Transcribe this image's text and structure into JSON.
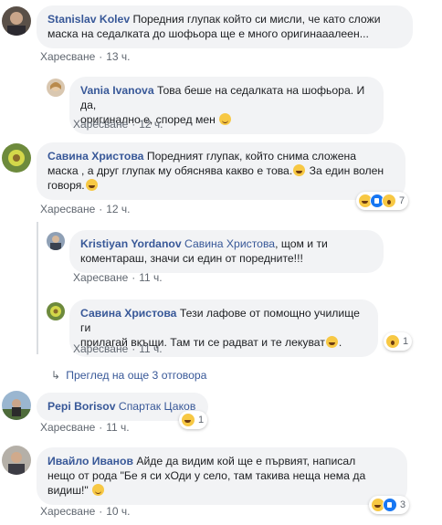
{
  "labels": {
    "like": "Харесване",
    "dot": "·"
  },
  "comments": [
    {
      "author": "Stanislav Kolev",
      "line1": "Поредния глупак който си мисли, че като сложи",
      "line2": "маска на седалката до шофьора ще е много оригинааалеен...",
      "time": "13 ч."
    },
    {
      "author": "Vania Ivanova",
      "line1": "Това беше на седалката на шофьора. И да,",
      "line2": "оригинално е, според мен",
      "time": "12 ч."
    },
    {
      "author": "Савина Христова",
      "line1": "Поредният глупак, който снима сложена",
      "line2": "маска , а друг глупак му обяснява какво е това.",
      "line2b": "За един волен",
      "line3": "говоря.",
      "time": "12 ч.",
      "react_count": "7"
    },
    {
      "author": "Kristiyan Yordanov",
      "mention": "Савина Христова",
      "line1": ", щом и ти",
      "line2": "коментараш, значи си един от поредните!!!",
      "time": "11 ч."
    },
    {
      "author": "Савина Христова",
      "line1": "Тези лафове от помощно училище ги",
      "line2": "прилагай вкъщи. Там ти се радват и те лекуват",
      "time": "11 ч.",
      "react_count": "1"
    },
    {
      "author": "Pepi Borisov",
      "mention": "Спартак Цаков",
      "time": "11 ч.",
      "react_count": "1"
    },
    {
      "author": "Ивайло Иванов",
      "line1": "Айде да видим кой ще е първият, написал",
      "line2": "нещо от рода \"Бе я си хОди у село, там такива неща нема да",
      "line3": "видиш!\"",
      "time": "10 ч.",
      "react_count": "3"
    }
  ],
  "more_replies": "Преглед на още 3 отговора"
}
